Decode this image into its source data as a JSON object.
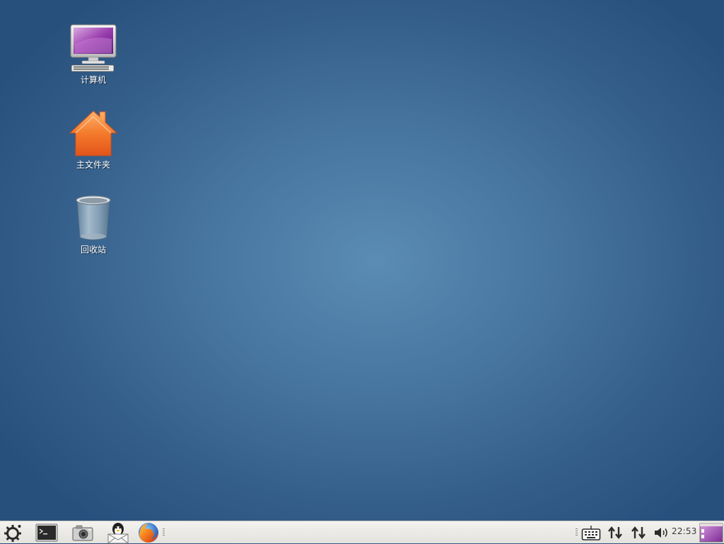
{
  "desktop": {
    "icons": [
      {
        "label": "计算机",
        "icon": "computer-icon"
      },
      {
        "label": "主文件夹",
        "icon": "home-folder-icon"
      },
      {
        "label": "回收站",
        "icon": "trash-icon"
      }
    ]
  },
  "taskbar": {
    "launchers": [
      {
        "name": "menu",
        "icon": "gear-menu-icon"
      },
      {
        "name": "terminal",
        "icon": "terminal-icon"
      },
      {
        "name": "screenshot",
        "icon": "camera-icon"
      },
      {
        "name": "qq",
        "icon": "penguin-icon"
      },
      {
        "name": "firefox",
        "icon": "firefox-icon"
      }
    ],
    "tray": [
      {
        "name": "keyboard",
        "icon": "keyboard-icon"
      },
      {
        "name": "network-1",
        "icon": "network-arrows-icon"
      },
      {
        "name": "network-2",
        "icon": "network-arrows-icon"
      },
      {
        "name": "volume",
        "icon": "volume-icon"
      }
    ],
    "clock": "22:53"
  },
  "colors": {
    "desktop_center": "#5b8cb3",
    "desktop_edge": "#28507d",
    "taskbar": "#eeece8",
    "home_orange": "#f2661e"
  }
}
